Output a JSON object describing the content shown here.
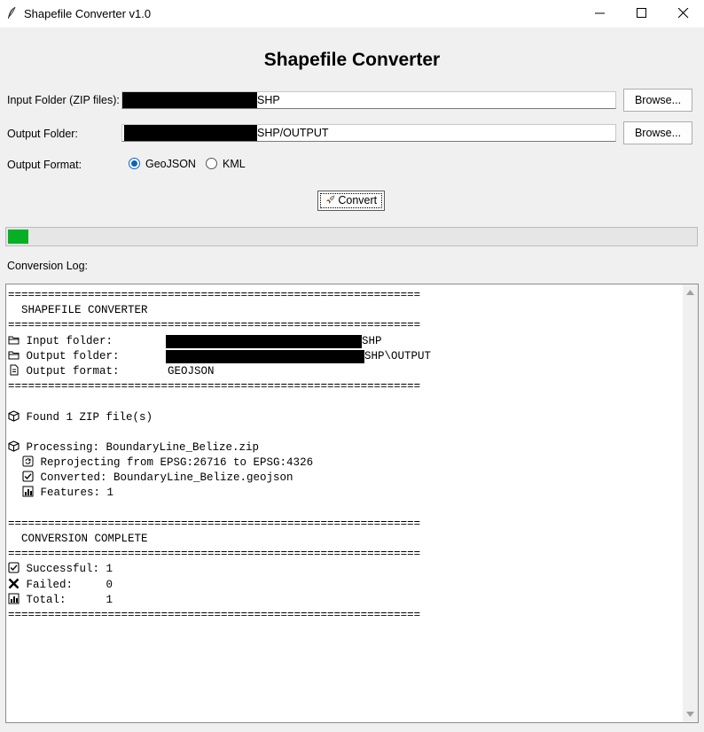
{
  "window": {
    "title": "Shapefile Converter v1.0",
    "icon": "feather-icon",
    "controls": [
      "minimize-icon",
      "maximize-icon",
      "close-icon"
    ]
  },
  "heading": "Shapefile Converter",
  "input_folder": {
    "label": "Input Folder (ZIP files):",
    "value_visible_suffix": "SHP",
    "redacted": true,
    "browse_label": "Browse..."
  },
  "output_folder": {
    "label": "Output Folder:",
    "value_visible_suffix": "SHP/OUTPUT",
    "redacted": true,
    "browse_label": "Browse..."
  },
  "output_format": {
    "label": "Output Format:",
    "options": [
      "GeoJSON",
      "KML"
    ],
    "selected": "GeoJSON"
  },
  "convert_button": {
    "label": "Convert",
    "icon": "rocket-icon"
  },
  "progress": {
    "value_fraction": 0.03,
    "color": "#06b025"
  },
  "log": {
    "label": "Conversion Log:",
    "lines": [
      {
        "icon": "",
        "text": "=============================================================="
      },
      {
        "icon": "",
        "text": "  SHAPEFILE CONVERTER"
      },
      {
        "icon": "",
        "text": "=============================================================="
      },
      {
        "icon": "folder-icon",
        "text": "Input folder:",
        "value": "SHP",
        "redacted": true
      },
      {
        "icon": "folder-icon",
        "text": "Output folder:",
        "value": "SHP\\OUTPUT",
        "redacted": true
      },
      {
        "icon": "document-icon",
        "text": "Output format:",
        "value": "GEOJSON"
      },
      {
        "icon": "",
        "text": "=============================================================="
      },
      {
        "icon": "",
        "text": ""
      },
      {
        "icon": "package-icon",
        "text": "Found 1 ZIP file(s)"
      },
      {
        "icon": "",
        "text": ""
      },
      {
        "icon": "package-icon",
        "text": "Processing: BoundaryLine_Belize.zip"
      },
      {
        "icon": "refresh-icon",
        "text": "Reprojecting from EPSG:26716 to EPSG:4326",
        "indent": true
      },
      {
        "icon": "checkbox-icon",
        "text": "Converted: BoundaryLine_Belize.geojson",
        "indent": true
      },
      {
        "icon": "bar-chart-icon",
        "text": "Features: 1",
        "indent": true
      },
      {
        "icon": "",
        "text": ""
      },
      {
        "icon": "",
        "text": "=============================================================="
      },
      {
        "icon": "",
        "text": "  CONVERSION COMPLETE"
      },
      {
        "icon": "",
        "text": "=============================================================="
      },
      {
        "icon": "checkbox-icon",
        "text": "Successful: 1"
      },
      {
        "icon": "cross-icon",
        "text": "Failed:     0"
      },
      {
        "icon": "bar-chart-icon",
        "text": "Total:      1"
      },
      {
        "icon": "",
        "text": "=============================================================="
      }
    ]
  }
}
